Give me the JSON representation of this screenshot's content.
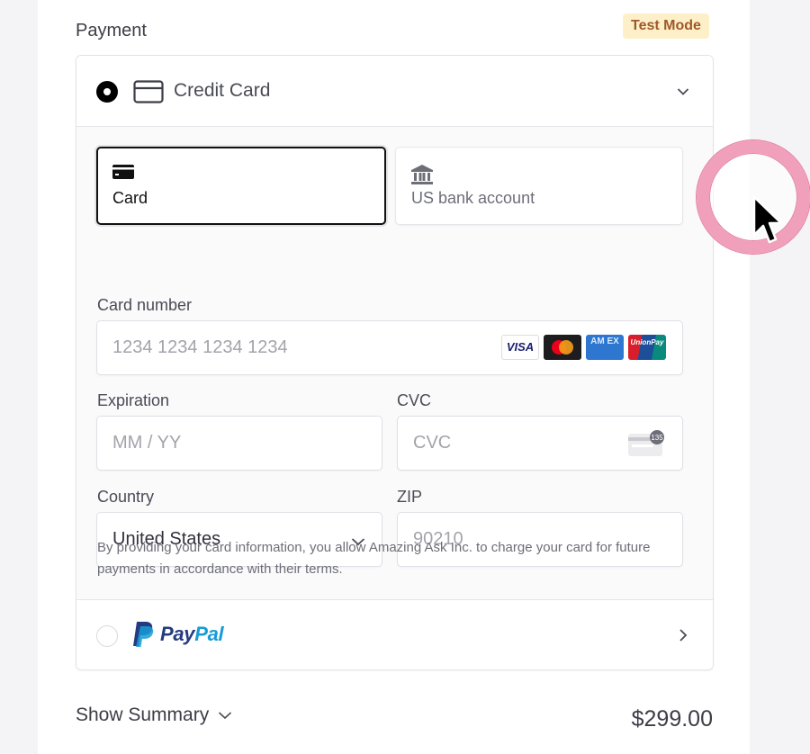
{
  "payment": {
    "title": "Payment",
    "test_mode_badge": "Test Mode"
  },
  "methods": {
    "credit_card": {
      "label": "Credit Card",
      "selected": true,
      "expanded": true,
      "tabs": [
        {
          "label": "Card",
          "icon": "credit-card-icon",
          "selected": true
        },
        {
          "label": "US bank account",
          "icon": "bank-icon",
          "selected": false
        }
      ],
      "card_number": {
        "label": "Card number",
        "placeholder": "1234 1234 1234 1234",
        "value": "",
        "brands": [
          "VISA",
          "Mastercard",
          "American Express",
          "UnionPay"
        ],
        "visa_text": "VISA",
        "amex_text": "AM EX",
        "union_text": "UnionPay"
      },
      "expiration": {
        "label": "Expiration",
        "placeholder": "MM / YY",
        "value": ""
      },
      "cvc": {
        "label": "CVC",
        "placeholder": "CVC",
        "value": "",
        "icon_badge": "135"
      },
      "country": {
        "label": "Country",
        "value": "United States"
      },
      "zip": {
        "label": "ZIP",
        "placeholder": "90210",
        "value": ""
      },
      "legal_text": "By providing your card information, you allow Amazing Ask Inc. to charge your card for future payments in accordance with their terms."
    },
    "paypal": {
      "label_pay": "Pay",
      "label_pal": "Pal",
      "selected": false
    }
  },
  "summary": {
    "toggle_label": "Show Summary",
    "total": "$299.00"
  },
  "colors": {
    "badge_bg": "#fdf0c8",
    "badge_text": "#a0582a",
    "paypal_dark": "#253b80",
    "paypal_light": "#179bd7",
    "click_indicator": "#f0a0bb"
  }
}
